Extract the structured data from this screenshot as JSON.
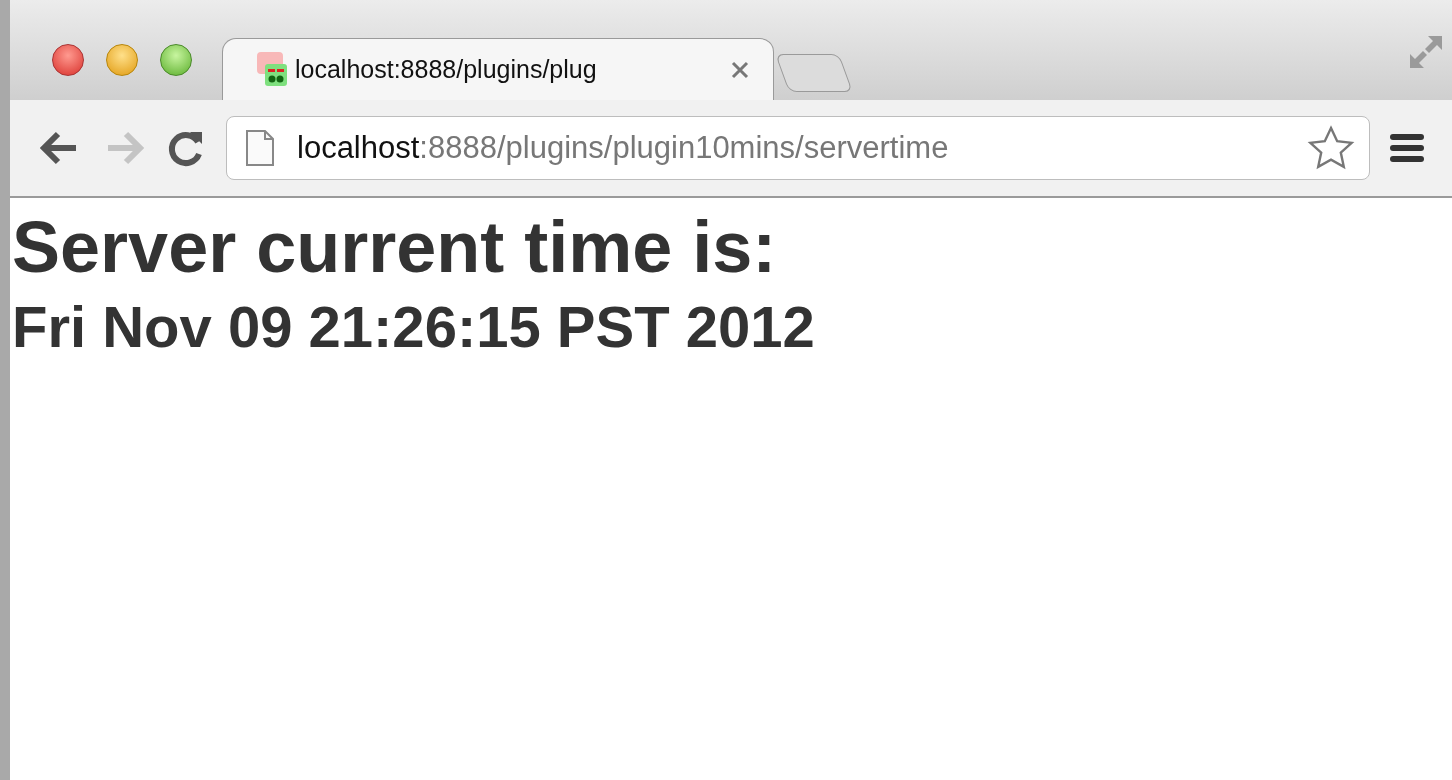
{
  "tabs": [
    {
      "title": "localhost:8888/plugins/plug",
      "selected": true
    }
  ],
  "address": {
    "host": "localhost",
    "rest": ":8888/plugins/plugin10mins/servertime"
  },
  "page": {
    "heading": "Server current time is:",
    "time": "Fri Nov 09 21:26:15 PST 2012"
  }
}
